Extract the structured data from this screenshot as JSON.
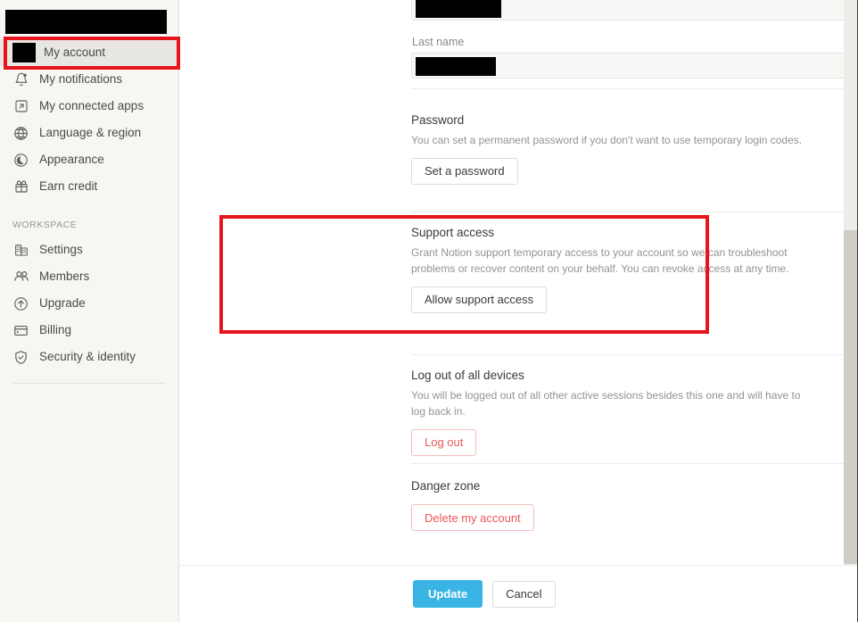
{
  "sidebar": {
    "account_title_redacted": true,
    "items": [
      {
        "label": "My account",
        "icon": "avatar-redacted",
        "selected": true
      },
      {
        "label": "My notifications",
        "icon": "bell-icon",
        "selected": false
      },
      {
        "label": "My connected apps",
        "icon": "external-link-icon",
        "selected": false
      },
      {
        "label": "Language & region",
        "icon": "globe-icon",
        "selected": false
      },
      {
        "label": "Appearance",
        "icon": "moon-icon",
        "selected": false
      },
      {
        "label": "Earn credit",
        "icon": "gift-icon",
        "selected": false
      }
    ],
    "workspace_section_label": "WORKSPACE",
    "workspace_items": [
      {
        "label": "Settings",
        "icon": "building-icon"
      },
      {
        "label": "Members",
        "icon": "people-icon"
      },
      {
        "label": "Upgrade",
        "icon": "arrow-up-circle-icon"
      },
      {
        "label": "Billing",
        "icon": "credit-card-icon"
      },
      {
        "label": "Security & identity",
        "icon": "shield-check-icon"
      }
    ]
  },
  "main": {
    "first_name": {
      "value": "",
      "redacted": true
    },
    "last_name": {
      "label": "Last name",
      "value": "",
      "redacted": true
    },
    "password": {
      "title": "Password",
      "description": "You can set a permanent password if you don't want to use temporary login codes.",
      "button_label": "Set a password"
    },
    "support_access": {
      "title": "Support access",
      "description": "Grant Notion support temporary access to your account so we can troubleshoot problems or recover content on your behalf. You can revoke access at any time.",
      "button_label": "Allow support access",
      "highlighted": true
    },
    "log_out_all_devices": {
      "title": "Log out of all devices",
      "description": "You will be logged out of all other active sessions besides this one and will have to log back in.",
      "button_label": "Log out"
    },
    "danger_zone": {
      "title": "Danger zone",
      "button_label": "Delete my account"
    }
  },
  "footer": {
    "update_label": "Update",
    "cancel_label": "Cancel"
  },
  "colors": {
    "accent_blue": "#39b4e5",
    "danger_red": "#eb5757",
    "annotation_red": "#e8141c",
    "sidebar_bg": "#f7f6f3",
    "selected_bg": "#e8e7e4"
  }
}
